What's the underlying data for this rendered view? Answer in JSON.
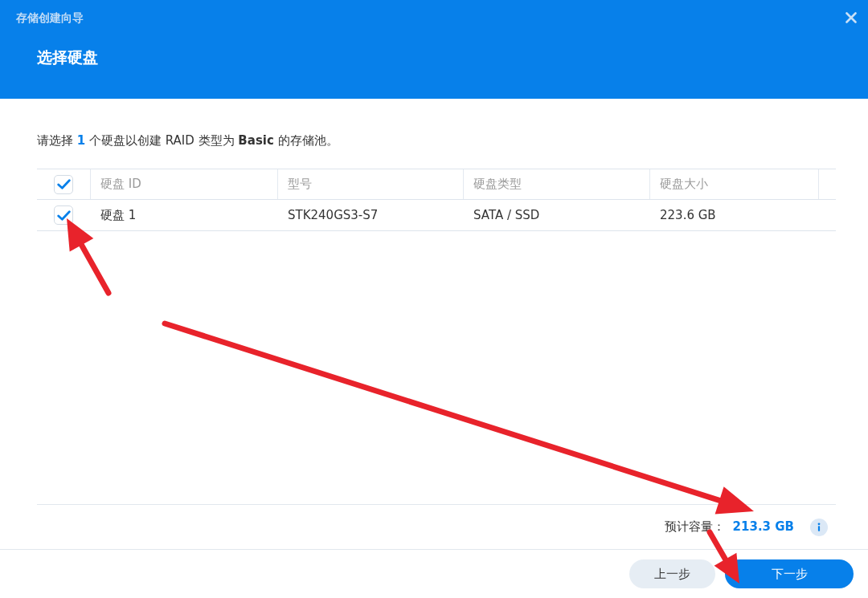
{
  "window": {
    "title": "存储创建向导"
  },
  "step_title": "选择硬盘",
  "instruction": {
    "text_before": "请选择",
    "count": "1",
    "text_after": "个硬盘以创建 RAID 类型为 **Basic** 的存储池。"
  },
  "table": {
    "select_all": {
      "checked": true
    },
    "columns": [
      "硬盘 ID",
      "型号",
      "硬盘类型",
      "硬盘大小"
    ],
    "rows": [
      {
        "checked": true,
        "cells": [
          "硬盘 1",
          "STK240GS3-S7",
          "SATA / SSD",
          "223.6 GB"
        ]
      }
    ]
  },
  "capacity": {
    "label": "预计容量：",
    "value": "213.3 GB"
  },
  "buttons": [
    {
      "label": "上一步",
      "kind": "secondary"
    },
    {
      "label": "下一步",
      "kind": "primary"
    }
  ]
}
